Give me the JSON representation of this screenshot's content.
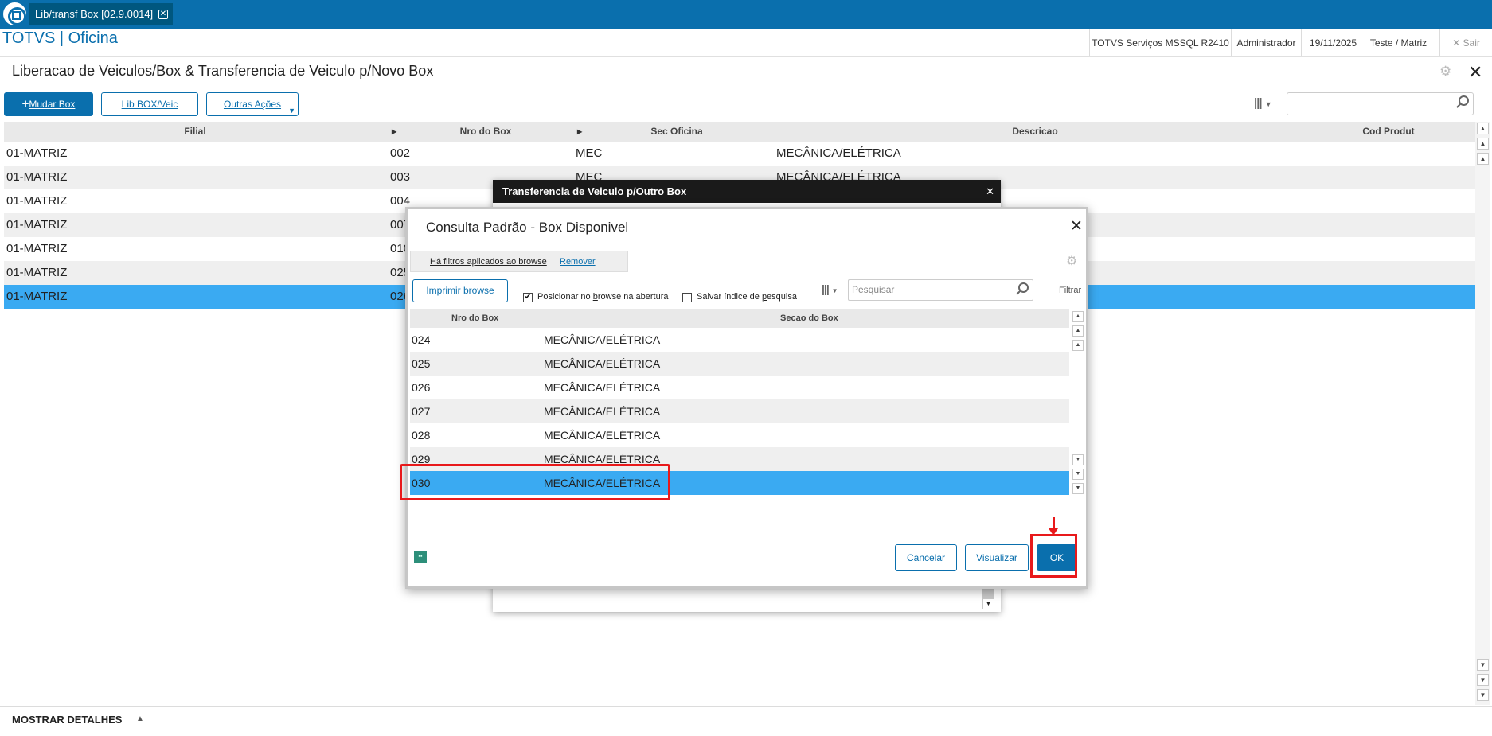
{
  "tab": {
    "label": "Lib/transf Box [02.9.0014]"
  },
  "header": {
    "brand": "TOTVS | Oficina",
    "server": "TOTVS Serviços MSSQL R2410",
    "user": "Administrador",
    "date": "19/11/2025",
    "branch": "Teste / Matriz",
    "exit_label": "Sair"
  },
  "page": {
    "title": "Liberacao de Veiculos/Box & Transferencia de Veiculo p/Novo Box"
  },
  "toolbar": {
    "mudar_box": "Mudar Box",
    "lib_box_veic": "Lib BOX/Veic",
    "outras_acoes": "Outras Ações"
  },
  "grid": {
    "columns": [
      "Filial",
      "Nro do Box",
      "Sec Oficina",
      "Descricao",
      "Cod Produt"
    ],
    "rows": [
      [
        "01-MATRIZ",
        "002",
        "MEC",
        "MECÂNICA/ELÉTRICA"
      ],
      [
        "01-MATRIZ",
        "003",
        "MEC",
        "MECÂNICA/ELÉTRICA"
      ],
      [
        "01-MATRIZ",
        "004",
        "",
        ""
      ],
      [
        "01-MATRIZ",
        "007",
        "",
        ""
      ],
      [
        "01-MATRIZ",
        "010",
        "",
        ""
      ],
      [
        "01-MATRIZ",
        "025",
        "",
        ""
      ],
      [
        "01-MATRIZ",
        "026",
        "",
        ""
      ]
    ]
  },
  "footer": {
    "label": "MOSTRAR DETALHES"
  },
  "bg_dialog": {
    "title": "Transferencia de Veiculo p/Outro Box"
  },
  "dialog": {
    "title": "Consulta Padrão - Box Disponivel",
    "filter_text": "Há filtros aplicados ao browse",
    "filter_remove": "Remover",
    "print_button": "Imprimir browse",
    "check1_pre": "Posicionar no ",
    "check1_u": "b",
    "check1_post": "rowse na abertura",
    "check2_pre": "Salvar índice de ",
    "check2_u": "p",
    "check2_post": "esquisa",
    "search_placeholder": "Pesquisar",
    "filtrar": "Filtrar",
    "columns": [
      "Nro do Box",
      "Secao do Box"
    ],
    "rows": [
      [
        "024",
        "MECÂNICA/ELÉTRICA"
      ],
      [
        "025",
        "MECÂNICA/ELÉTRICA"
      ],
      [
        "026",
        "MECÂNICA/ELÉTRICA"
      ],
      [
        "027",
        "MECÂNICA/ELÉTRICA"
      ],
      [
        "028",
        "MECÂNICA/ELÉTRICA"
      ],
      [
        "029",
        "MECÂNICA/ELÉTRICA"
      ],
      [
        "030",
        "MECÂNICA/ELÉTRICA"
      ]
    ],
    "selected_row": "030",
    "cancel": "Cancelar",
    "view": "Visualizar",
    "ok": "OK"
  },
  "colors": {
    "accent": "#0a6fad",
    "selected_row": "#3aaaf2",
    "highlight": "#e8191b",
    "title_bar_dark": "#1a1a1a"
  },
  "icons": [
    "totvs-logo-icon",
    "close-icon",
    "gear-icon",
    "columns-icon",
    "search-icon",
    "sort-arrow-icon",
    "scroll-arrow-icon",
    "checkbox-icon",
    "red-arrow-icon"
  ]
}
